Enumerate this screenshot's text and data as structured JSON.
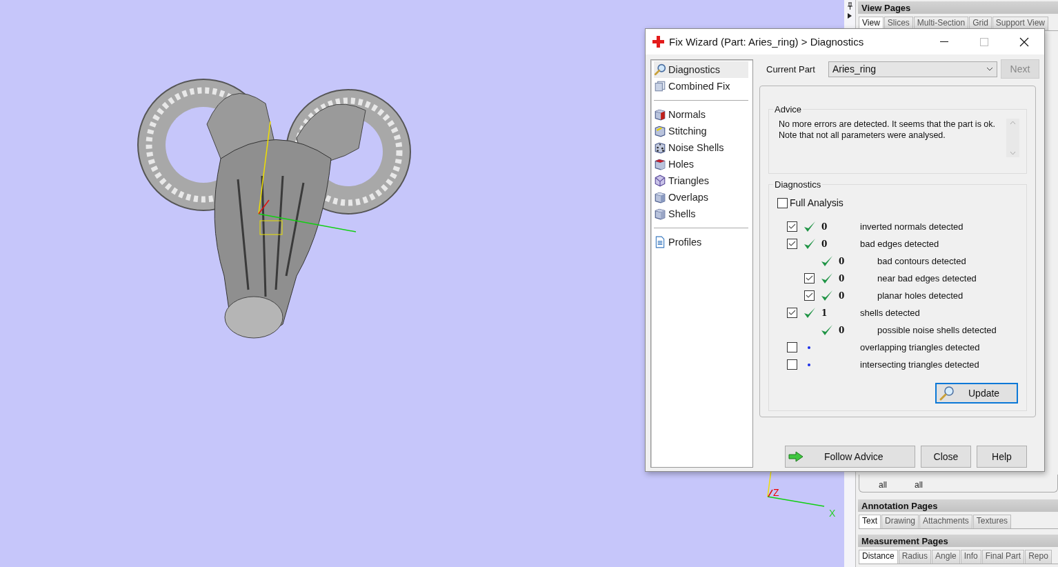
{
  "viewport": {
    "axis_labels": [
      "Z",
      "X"
    ]
  },
  "dialog": {
    "title": "Fix Wizard (Part: Aries_ring) > Diagnostics",
    "sidebar": {
      "groups": [
        [
          {
            "label": "Diagnostics",
            "selected": true
          },
          {
            "label": "Combined Fix",
            "selected": false
          }
        ],
        [
          {
            "label": "Normals",
            "selected": false
          },
          {
            "label": "Stitching",
            "selected": false
          },
          {
            "label": "Noise Shells",
            "selected": false
          },
          {
            "label": "Holes",
            "selected": false
          },
          {
            "label": "Triangles",
            "selected": false
          },
          {
            "label": "Overlaps",
            "selected": false
          },
          {
            "label": "Shells",
            "selected": false
          }
        ],
        [
          {
            "label": "Profiles",
            "selected": false
          }
        ]
      ]
    },
    "current_part": {
      "label": "Current Part",
      "value": "Aries_ring"
    },
    "next_button": {
      "label": "Next",
      "disabled": true
    },
    "advice": {
      "title": "Advice",
      "text": "No more errors are detected. It seems that the part is ok. Note that not all parameters were analysed."
    },
    "diagnostics": {
      "title": "Diagnostics",
      "full_analysis": {
        "label": "Full Analysis",
        "checked": false
      },
      "rows": [
        {
          "kind": "checkbox",
          "checked": true,
          "analysed": true,
          "count": "0",
          "label": "inverted normals detected"
        },
        {
          "kind": "checkbox",
          "checked": true,
          "analysed": true,
          "count": "0",
          "label": "bad edges detected",
          "children": [
            {
              "kind": "plain",
              "analysed": true,
              "count": "0",
              "label": "bad contours detected"
            },
            {
              "kind": "checkbox",
              "checked": true,
              "analysed": true,
              "count": "0",
              "label": "near bad edges detected"
            },
            {
              "kind": "checkbox",
              "checked": true,
              "analysed": true,
              "count": "0",
              "label": "planar holes detected"
            }
          ]
        },
        {
          "kind": "checkbox",
          "checked": true,
          "analysed": true,
          "count": "1",
          "label": "shells detected",
          "children": [
            {
              "kind": "plain",
              "analysed": true,
              "count": "0",
              "label": "possible noise shells detected"
            }
          ]
        },
        {
          "kind": "checkbox",
          "checked": false,
          "analysed": false,
          "label": "overlapping triangles detected"
        },
        {
          "kind": "checkbox",
          "checked": false,
          "analysed": false,
          "label": "intersecting triangles detected"
        }
      ],
      "update_button": "Update"
    },
    "buttons": {
      "follow_advice": "Follow Advice",
      "close": "Close",
      "help": "Help"
    }
  },
  "panel": {
    "view_pages": {
      "title": "View Pages",
      "tabs": [
        {
          "label": "View",
          "selected": true
        },
        {
          "label": "Slices",
          "selected": false
        },
        {
          "label": "Multi-Section",
          "selected": false
        },
        {
          "label": "Grid",
          "selected": false
        },
        {
          "label": "Support View",
          "selected": false
        }
      ],
      "toolbar": [
        "all",
        "all"
      ]
    },
    "annotation_pages": {
      "title": "Annotation Pages",
      "tabs": [
        {
          "label": "Text",
          "selected": true
        },
        {
          "label": "Drawing",
          "selected": false
        },
        {
          "label": "Attachments",
          "selected": false
        },
        {
          "label": "Textures",
          "selected": false
        }
      ]
    },
    "measurement_pages": {
      "title": "Measurement Pages",
      "tabs": [
        {
          "label": "Distance",
          "selected": true
        },
        {
          "label": "Radius",
          "selected": false
        },
        {
          "label": "Angle",
          "selected": false
        },
        {
          "label": "Info",
          "selected": false
        },
        {
          "label": "Final Part",
          "selected": false
        },
        {
          "label": "Repo",
          "selected": false
        }
      ]
    }
  }
}
